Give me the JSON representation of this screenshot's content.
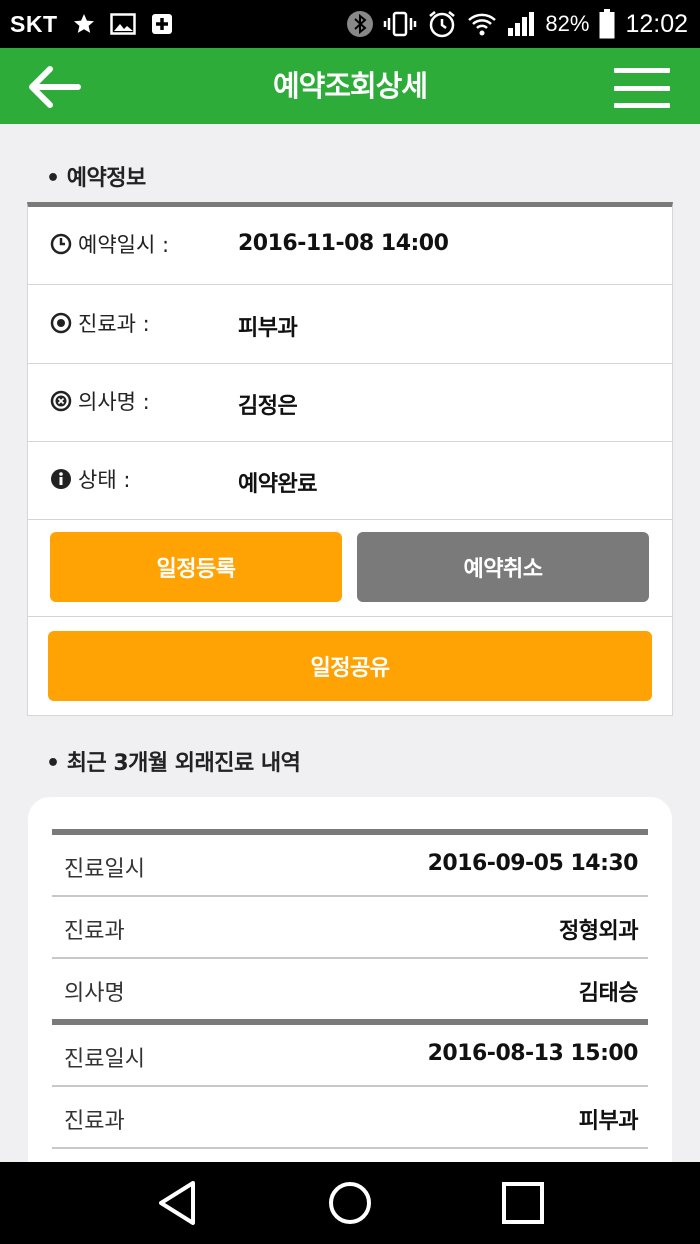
{
  "status_bar": {
    "carrier": "SKT",
    "battery": "82%",
    "time": "12:02"
  },
  "app_bar": {
    "title": "예약조회상세"
  },
  "reservation": {
    "section_title": "• 예약정보",
    "rows": [
      {
        "label": "예약일시 :",
        "value": "2016-11-08 14:00",
        "icon": "clock-icon"
      },
      {
        "label": "진료과 :",
        "value": "피부과",
        "icon": "dot-circle-icon"
      },
      {
        "label": "의사명 :",
        "value": "김정은",
        "icon": "x-circle-icon"
      },
      {
        "label": "상태 :",
        "value": "예약완료",
        "icon": "info-icon"
      }
    ],
    "buttons": {
      "register": "일정등록",
      "cancel": "예약취소",
      "share": "일정공유"
    }
  },
  "history": {
    "section_title": "• 최근 3개월 외래진료 내역",
    "records": [
      [
        {
          "label": "진료일시",
          "value": "2016-09-05 14:30"
        },
        {
          "label": "진료과",
          "value": "정형외과"
        },
        {
          "label": "의사명",
          "value": "김태승"
        }
      ],
      [
        {
          "label": "진료일시",
          "value": "2016-08-13 15:00"
        },
        {
          "label": "진료과",
          "value": "피부과"
        }
      ]
    ]
  },
  "colors": {
    "appbar": "#2eac3a",
    "accent_orange": "#ffa203",
    "button_gray": "#7a7a7a"
  }
}
